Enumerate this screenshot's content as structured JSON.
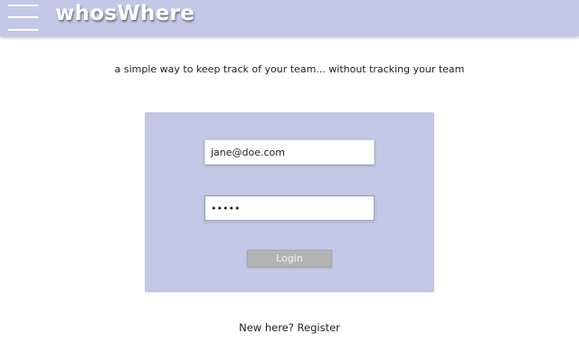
{
  "header": {
    "brand": "whosWhere",
    "menu_icon": "hamburger-menu-icon"
  },
  "tagline": "a simple way to keep track of your team... without tracking your team",
  "login": {
    "email_value": "jane@doe.com",
    "password_value": "12345",
    "submit_label": "Login"
  },
  "register": {
    "prompt": "New here?",
    "link_label": "Register"
  },
  "colors": {
    "header_bg": "#c3c8e6",
    "panel_bg": "#c3c8e6",
    "button_bg": "#b4b4b4"
  }
}
